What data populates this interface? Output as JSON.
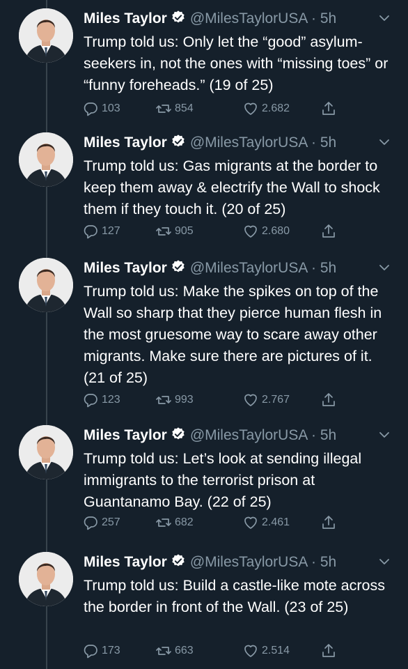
{
  "tweets": [
    {
      "name": "Miles Taylor",
      "handle": "@MilesTaylorUSA",
      "time": "· 5h",
      "text": "Trump told us: Only let the “good” asylum-seekers in, not the ones with “missing toes” or “funny foreheads.” (19 of 25)",
      "replies": "103",
      "retweets": "854",
      "likes": "2.682"
    },
    {
      "name": "Miles Taylor",
      "handle": "@MilesTaylorUSA",
      "time": "· 5h",
      "text": "Trump told us: Gas migrants at the border to keep them away & electrify the Wall to shock them if they touch it. (20 of 25)",
      "replies": "127",
      "retweets": "905",
      "likes": "2.680"
    },
    {
      "name": "Miles Taylor",
      "handle": "@MilesTaylorUSA",
      "time": "· 5h",
      "text": "Trump told us: Make the spikes on top of the Wall so sharp that they pierce human flesh in the most gruesome way to scare away other migrants. Make sure there are pictures of it. (21 of 25)",
      "replies": "123",
      "retweets": "993",
      "likes": "2.767"
    },
    {
      "name": "Miles Taylor",
      "handle": "@MilesTaylorUSA",
      "time": "· 5h",
      "text": "Trump told us: Let’s look at sending illegal immigrants to the terrorist prison at Guantanamo Bay. (22 of 25)",
      "replies": "257",
      "retweets": "682",
      "likes": "2.461"
    },
    {
      "name": "Miles Taylor",
      "handle": "@MilesTaylorUSA",
      "time": "· 5h",
      "text": "Trump told us: Build a castle-like mote across the border in front of the Wall. (23 of 25)",
      "replies": "173",
      "retweets": "663",
      "likes": "2.514"
    }
  ],
  "icons": {
    "reply": "reply-icon",
    "retweet": "retweet-icon",
    "like": "heart-icon",
    "share": "share-icon",
    "verified": "verified-badge-icon",
    "more": "chevron-down-icon"
  },
  "colors": {
    "background": "#15202b",
    "secondary_text": "#8899a6",
    "verified_badge": "#ffffff",
    "thread_line": "#38444d"
  }
}
